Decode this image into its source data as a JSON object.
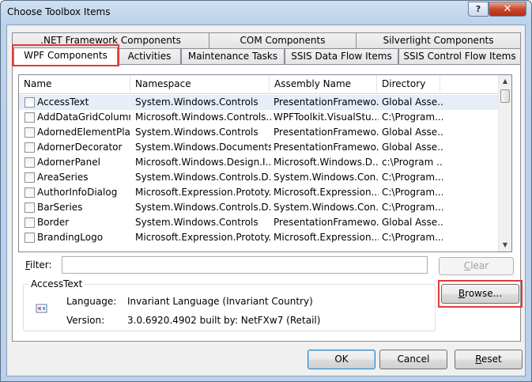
{
  "window": {
    "title": "Choose Toolbox Items",
    "help_label": "?",
    "close_label": "✕"
  },
  "tabs_row1": [
    ".NET Framework Components",
    "COM Components",
    "Silverlight Components"
  ],
  "tabs_row2": [
    "WPF Components",
    "Activities",
    "Maintenance Tasks",
    "SSIS Data Flow Items",
    "SSIS Control Flow Items"
  ],
  "active_tab": "WPF Components",
  "list": {
    "columns": [
      "Name",
      "Namespace",
      "Assembly Name",
      "Directory"
    ],
    "rows": [
      [
        "AccessText",
        "System.Windows.Controls",
        "PresentationFramewo...",
        "Global Asse..."
      ],
      [
        "AddDataGridColumn...",
        "Microsoft.Windows.Controls....",
        "WPFToolkit.VisualStu...",
        "C:\\Program..."
      ],
      [
        "AdornedElementPlac...",
        "System.Windows.Controls",
        "PresentationFramewo...",
        "Global Asse..."
      ],
      [
        "AdornerDecorator",
        "System.Windows.Documents",
        "PresentationFramewo...",
        "Global Asse..."
      ],
      [
        "AdornerPanel",
        "Microsoft.Windows.Design.I...",
        "Microsoft.Windows.D...",
        "c:\\Program ..."
      ],
      [
        "AreaSeries",
        "System.Windows.Controls.D...",
        "System.Windows.Con...",
        "C:\\Program..."
      ],
      [
        "AuthorInfoDialog",
        "Microsoft.Expression.Prototy...",
        "Microsoft.Expression....",
        "C:\\Program..."
      ],
      [
        "BarSeries",
        "System.Windows.Controls.D...",
        "System.Windows.Con...",
        "C:\\Program..."
      ],
      [
        "Border",
        "System.Windows.Controls",
        "PresentationFramewo...",
        "Global Asse..."
      ],
      [
        "BrandingLogo",
        "Microsoft.Expression.Prototy...",
        "Microsoft.Expression....",
        "C:\\Program..."
      ]
    ],
    "selected_index": 0,
    "scroll_up": "▲",
    "scroll_down": "▼"
  },
  "filter": {
    "label_prefix": "F",
    "label_rest": "ilter:",
    "value": "",
    "clear_prefix": "C",
    "clear_rest": "lear"
  },
  "details": {
    "group_title": "AccessText",
    "language_label": "Language:",
    "language_value": "Invariant Language (Invariant Country)",
    "version_label": "Version:",
    "version_value": "3.0.6920.4902 built by: NetFXw7 (Retail)"
  },
  "buttons": {
    "browse_prefix": "B",
    "browse_rest": "rowse...",
    "ok": "OK",
    "cancel": "Cancel",
    "reset_prefix": "R",
    "reset_rest": "eset"
  }
}
